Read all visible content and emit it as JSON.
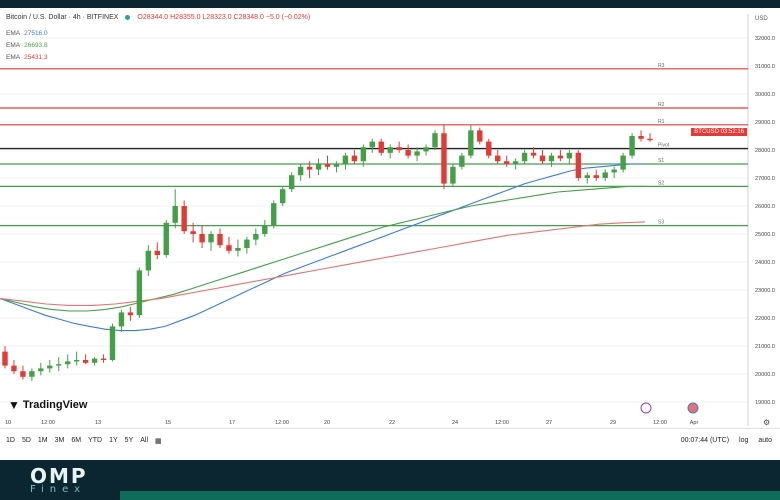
{
  "header": {
    "symbol": "Bitcoin / U.S. Dollar · 4h · BITFINEX",
    "ohlc": "O28344.0 H28355.0 L28323.0 C28348.0 −5.0 (−0.02%)",
    "currency": "USD"
  },
  "ema": [
    {
      "label": "EMA",
      "value": "27516.0",
      "color": "#3b7ddd"
    },
    {
      "label": "EMA",
      "value": "26693.8",
      "color": "#43a047"
    },
    {
      "label": "EMA",
      "value": "25431.3",
      "color": "#e53935"
    }
  ],
  "price_tag": {
    "symbol": "BTCUSD",
    "value": "03:52:16",
    "color": "#e53935"
  },
  "pivot_labels": [
    "R3",
    "R2",
    "R1",
    "Pivot",
    "S1",
    "S2",
    "S3"
  ],
  "timeframes": [
    "1D",
    "5D",
    "1M",
    "3M",
    "6M",
    "YTD",
    "1Y",
    "5Y",
    "All"
  ],
  "bottom_right": {
    "clock": "00:07:44 (UTC)",
    "log": "log",
    "auto": "auto"
  },
  "brand": {
    "tradingview": "TradingView",
    "omp": "OMP",
    "finex": "Finex"
  },
  "chart_data": {
    "type": "candlestick",
    "title": "Bitcoin / U.S. Dollar · 4h · BITFINEX",
    "ylim": [
      18500,
      32500
    ],
    "y_ticks": [
      32000,
      31000,
      30000,
      29000,
      28000,
      27000,
      26000,
      25000,
      24000,
      23000,
      22000,
      21000,
      20000,
      19000
    ],
    "y_tick_labels": [
      "32000.0",
      "31000.0",
      "30000.0",
      "29000.0",
      "28000.0",
      "27000.0",
      "26000.0",
      "25000.0",
      "24000.0",
      "23000.0",
      "22000.0",
      "21000.0",
      "20000.0",
      "19000.0"
    ],
    "x_tick_labels": [
      "10",
      "12:00",
      "13",
      "15",
      "17",
      "12:00",
      "20",
      "22",
      "24",
      "12:00",
      "27",
      "29",
      "12:00",
      "Apr"
    ],
    "horizontal_lines": [
      {
        "name": "R3",
        "value": 30900,
        "color": "#e53935"
      },
      {
        "name": "R2",
        "value": 29500,
        "color": "#e53935"
      },
      {
        "name": "R1",
        "value": 28900,
        "color": "#e53935"
      },
      {
        "name": "Pivot",
        "value": 28050,
        "color": "#222222"
      },
      {
        "name": "S1",
        "value": 27500,
        "color": "#43a047"
      },
      {
        "name": "S2",
        "value": 26700,
        "color": "#43a047"
      },
      {
        "name": "S3",
        "value": 25300,
        "color": "#43a047"
      }
    ],
    "candles": [
      [
        20800,
        21000,
        20200,
        20300
      ],
      [
        20300,
        20500,
        20000,
        20100
      ],
      [
        20100,
        20300,
        19800,
        19900
      ],
      [
        19900,
        20200,
        19750,
        20100
      ],
      [
        20100,
        20400,
        19950,
        20200
      ],
      [
        20200,
        20500,
        20050,
        20300
      ],
      [
        20300,
        20600,
        20100,
        20350
      ],
      [
        20350,
        20700,
        20200,
        20450
      ],
      [
        20450,
        20800,
        20300,
        20500
      ],
      [
        20500,
        20700,
        20350,
        20400
      ],
      [
        20400,
        20600,
        20300,
        20550
      ],
      [
        20550,
        20700,
        20400,
        20500
      ],
      [
        20500,
        21800,
        20450,
        21700
      ],
      [
        21700,
        22300,
        21500,
        22200
      ],
      [
        22200,
        22400,
        21900,
        22100
      ],
      [
        22100,
        23800,
        22000,
        23700
      ],
      [
        23700,
        24600,
        23500,
        24400
      ],
      [
        24400,
        24700,
        24100,
        24250
      ],
      [
        24250,
        25500,
        24150,
        25400
      ],
      [
        25400,
        26600,
        25200,
        26000
      ],
      [
        26000,
        26200,
        25000,
        25100
      ],
      [
        25100,
        25400,
        24700,
        25000
      ],
      [
        25000,
        25300,
        24500,
        24700
      ],
      [
        24700,
        25100,
        24400,
        25000
      ],
      [
        25000,
        25200,
        24500,
        24600
      ],
      [
        24600,
        24900,
        24300,
        24400
      ],
      [
        24400,
        24800,
        24200,
        24500
      ],
      [
        24500,
        24900,
        24300,
        24800
      ],
      [
        24800,
        25200,
        24600,
        25000
      ],
      [
        25000,
        25500,
        24900,
        25300
      ],
      [
        25300,
        26200,
        25200,
        26100
      ],
      [
        26100,
        26700,
        26000,
        26600
      ],
      [
        26600,
        27200,
        26500,
        27100
      ],
      [
        27100,
        27500,
        26900,
        27400
      ],
      [
        27400,
        27600,
        27000,
        27300
      ],
      [
        27300,
        27700,
        27100,
        27500
      ],
      [
        27500,
        27800,
        27300,
        27400
      ],
      [
        27400,
        27600,
        27200,
        27500
      ],
      [
        27500,
        27900,
        27300,
        27800
      ],
      [
        27800,
        28000,
        27500,
        27600
      ],
      [
        27600,
        28200,
        27400,
        28100
      ],
      [
        28100,
        28400,
        27900,
        28300
      ],
      [
        28300,
        28400,
        27800,
        27900
      ],
      [
        27900,
        28200,
        27700,
        28100
      ],
      [
        28100,
        28300,
        27900,
        28000
      ],
      [
        28000,
        28200,
        27700,
        27800
      ],
      [
        27800,
        28100,
        27600,
        27950
      ],
      [
        27950,
        28200,
        27800,
        28100
      ],
      [
        28100,
        28700,
        28000,
        28600
      ],
      [
        28600,
        28900,
        26600,
        26800
      ],
      [
        26800,
        27500,
        26700,
        27400
      ],
      [
        27400,
        27900,
        27300,
        27800
      ],
      [
        27800,
        28900,
        27700,
        28700
      ],
      [
        28700,
        28800,
        28200,
        28300
      ],
      [
        28300,
        28400,
        27700,
        27800
      ],
      [
        27800,
        28000,
        27500,
        27600
      ],
      [
        27600,
        27800,
        27400,
        27500
      ],
      [
        27500,
        27700,
        27300,
        27600
      ],
      [
        27600,
        28000,
        27500,
        27900
      ],
      [
        27900,
        28100,
        27700,
        27800
      ],
      [
        27800,
        28000,
        27500,
        27600
      ],
      [
        27600,
        27900,
        27400,
        27800
      ],
      [
        27800,
        28000,
        27600,
        27700
      ],
      [
        27700,
        28000,
        27500,
        27900
      ],
      [
        27900,
        28000,
        26900,
        27000
      ],
      [
        27000,
        27200,
        26800,
        27100
      ],
      [
        27100,
        27300,
        26900,
        27000
      ],
      [
        27000,
        27300,
        26900,
        27200
      ],
      [
        27200,
        27400,
        27000,
        27300
      ],
      [
        27300,
        27900,
        27200,
        27800
      ],
      [
        27800,
        28600,
        27700,
        28500
      ],
      [
        28500,
        28700,
        28300,
        28400
      ],
      [
        28400,
        28600,
        28300,
        28350
      ]
    ],
    "series": [
      {
        "name": "EMA",
        "color": "#3b7ddd",
        "values": [
          22700,
          22500,
          22300,
          22100,
          21950,
          21800,
          21700,
          21600,
          21550,
          21550,
          21600,
          21700,
          21900,
          22100,
          22350,
          22600,
          22850,
          23100,
          23350,
          23600,
          23800,
          24000,
          24200,
          24400,
          24600,
          24800,
          25000,
          25200,
          25400,
          25600,
          25800,
          26000,
          26200,
          26400,
          26600,
          26800,
          26950,
          27100,
          27250,
          27350,
          27400,
          27450,
          27500,
          27500
        ]
      },
      {
        "name": "EMA",
        "color": "#43a047",
        "values": [
          22700,
          22550,
          22400,
          22300,
          22250,
          22250,
          22300,
          22400,
          22550,
          22700,
          22850,
          23050,
          23250,
          23450,
          23650,
          23850,
          24050,
          24250,
          24450,
          24650,
          24850,
          25050,
          25250,
          25400,
          25550,
          25700,
          25850,
          26000,
          26100,
          26200,
          26300,
          26400,
          26500,
          26550,
          26600,
          26650,
          26700,
          26700
        ]
      },
      {
        "name": "EMA",
        "color": "#e57373",
        "values": [
          22700,
          22600,
          22500,
          22450,
          22450,
          22500,
          22600,
          22700,
          22850,
          23000,
          23150,
          23300,
          23450,
          23600,
          23750,
          23900,
          24050,
          24200,
          24350,
          24500,
          24650,
          24800,
          24950,
          25050,
          25150,
          25250,
          25350,
          25400,
          25431
        ]
      }
    ]
  }
}
